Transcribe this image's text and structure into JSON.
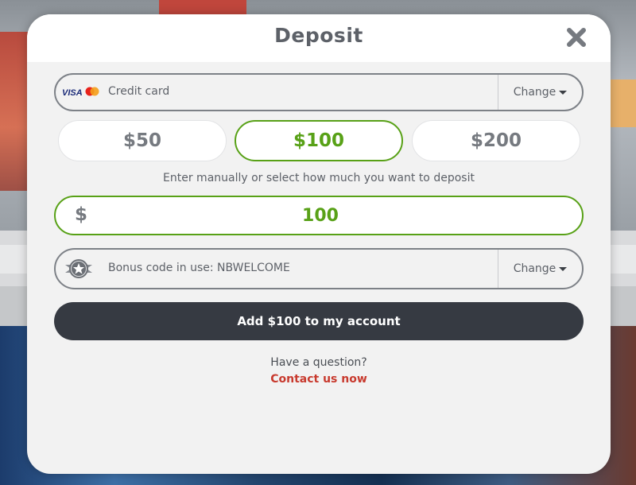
{
  "modal": {
    "title": "Deposit",
    "close_icon": "close-icon"
  },
  "payment": {
    "logos": [
      "visa-logo",
      "mastercard-logo"
    ],
    "method_label": "Credit card",
    "change_label": "Change"
  },
  "amount_options": [
    {
      "label": "$50",
      "selected": false
    },
    {
      "label": "$100",
      "selected": true
    },
    {
      "label": "$200",
      "selected": false
    }
  ],
  "hint_text": "Enter manually or select how much you want to deposit",
  "amount_input": {
    "currency_symbol": "$",
    "value": "100"
  },
  "bonus": {
    "icon": "star-badge-icon",
    "label": "Bonus code in use: NBWELCOME",
    "change_label": "Change"
  },
  "submit_label": "Add $100 to my account",
  "help": {
    "question": "Have a question?",
    "contact_label": "Contact us now"
  },
  "colors": {
    "accent_green": "#58a117",
    "dark_button": "#363a42",
    "link_red": "#c83a2e",
    "text_gray": "#5d6168"
  }
}
